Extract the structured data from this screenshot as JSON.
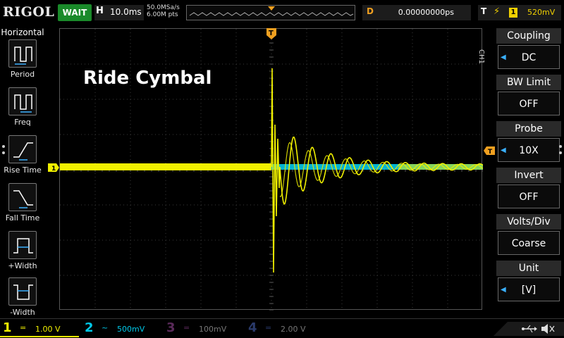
{
  "topbar": {
    "brand": "RIGOL",
    "run_status": "WAIT",
    "horizontal_letter": "H",
    "timebase": "10.0ms",
    "sample_rate": "50.0MSa/s",
    "memory_depth": "6.00M pts",
    "trigger_marker": "T",
    "delay_letter": "D",
    "delay_value": "0.00000000ps",
    "trigger_letter": "T",
    "trigger_edge": "rising-edge-icon",
    "trigger_channel": "1",
    "trigger_level": "520mV"
  },
  "left_menu": {
    "title": "Horizontal",
    "items": [
      {
        "label": "Period",
        "icon": "period-icon"
      },
      {
        "label": "Freq",
        "icon": "freq-icon"
      },
      {
        "label": "Rise Time",
        "icon": "rise-time-icon"
      },
      {
        "label": "Fall Time",
        "icon": "fall-time-icon"
      },
      {
        "label": "+Width",
        "icon": "positive-width-icon"
      },
      {
        "label": "-Width",
        "icon": "negative-width-icon"
      }
    ]
  },
  "overlay": {
    "title": "Ride Cymbal"
  },
  "waveform": {
    "ch1_marker": "1",
    "trigger_top_marker": "T",
    "trigger_level_marker": "T",
    "ch1_color": "#f0f000",
    "ch2_color": "#00c8e8"
  },
  "right_menu": {
    "channel_tag": "CH1",
    "items": [
      {
        "label": "Coupling",
        "value": "DC",
        "has_arrow": true
      },
      {
        "label": "BW Limit",
        "value": "OFF",
        "has_arrow": false
      },
      {
        "label": "Probe",
        "value": "10X",
        "has_arrow": true
      },
      {
        "label": "Invert",
        "value": "OFF",
        "has_arrow": false
      },
      {
        "label": "Volts/Div",
        "value": "Coarse",
        "has_arrow": false
      },
      {
        "label": "Unit",
        "value": "[V]",
        "has_arrow": true
      }
    ]
  },
  "bottom_bar": {
    "channels": [
      {
        "num": "1",
        "coupling": "=",
        "scale": "1.00 V",
        "color": "#f0f000"
      },
      {
        "num": "2",
        "coupling": "~",
        "scale": "500mV",
        "color": "#00c8e8"
      },
      {
        "num": "3",
        "coupling": "=",
        "scale": "100mV",
        "color": "#d000d0"
      },
      {
        "num": "4",
        "coupling": "=",
        "scale": "2.00 V",
        "color": "#3070ff"
      }
    ],
    "usb_icon": "usb-icon",
    "speaker_icon": "speaker-muted-icon"
  },
  "colors": {
    "run_status_bg": "#1a8a2a",
    "delay_accent": "#f0a020",
    "trigger_accent": "#f0d000",
    "menu_arrow": "#3ab0ff"
  }
}
